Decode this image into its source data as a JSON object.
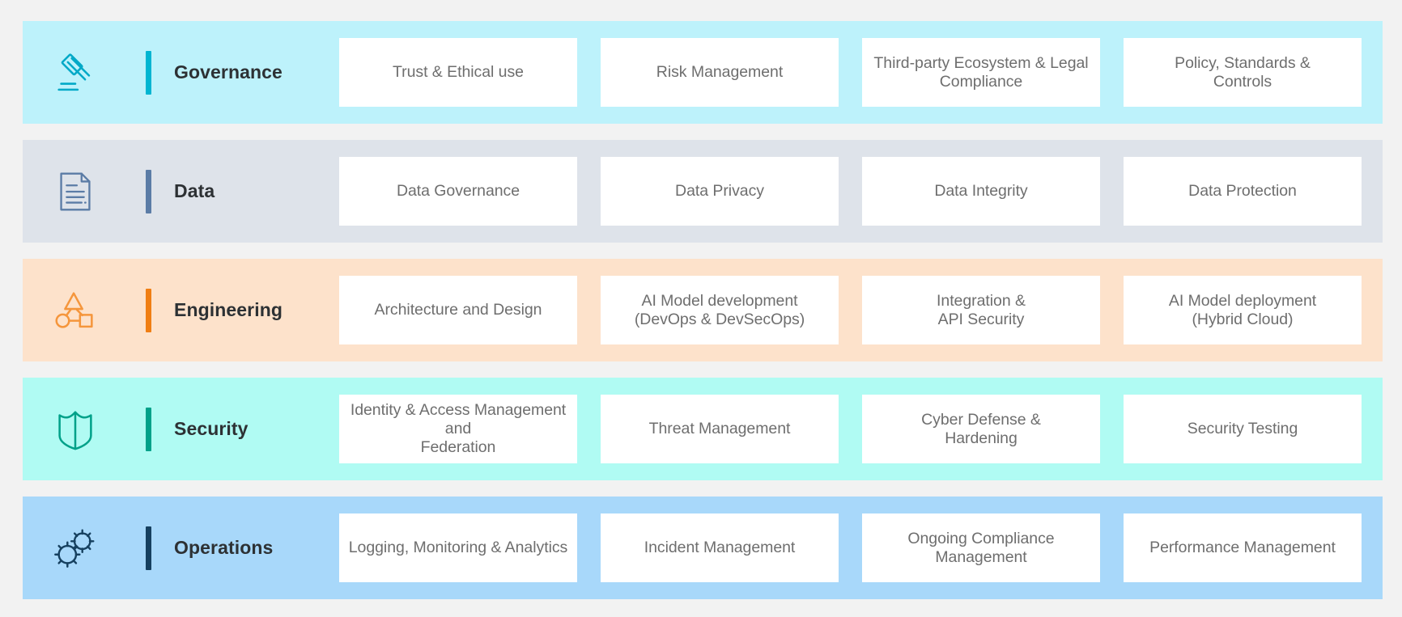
{
  "page": {
    "background": "#f2f2f2",
    "card_background": "#ffffff",
    "card_text_color": "#6e6e6e",
    "row_label_color": "#2d3134"
  },
  "rows": [
    {
      "id": "governance",
      "label": "Governance",
      "icon": "gavel-icon",
      "band_color": "#bdf2fb",
      "accent_color": "#00b5d1",
      "icon_color": "#00a9c7",
      "cards": [
        {
          "label": "Trust & Ethical use"
        },
        {
          "label": "Risk Management"
        },
        {
          "label": "Third-party Ecosystem & Legal\nCompliance"
        },
        {
          "label": "Policy, Standards &\nControls"
        }
      ]
    },
    {
      "id": "data",
      "label": "Data",
      "icon": "document-icon",
      "band_color": "#dee3ea",
      "accent_color": "#5b7ca6",
      "icon_color": "#5b7ca6",
      "cards": [
        {
          "label": "Data Governance"
        },
        {
          "label": "Data Privacy"
        },
        {
          "label": "Data Integrity"
        },
        {
          "label": "Data Protection"
        }
      ]
    },
    {
      "id": "engineering",
      "label": "Engineering",
      "icon": "shapes-network-icon",
      "band_color": "#fde2cb",
      "accent_color": "#f07e13",
      "icon_color": "#f5963c",
      "cards": [
        {
          "label": "Architecture and Design"
        },
        {
          "label": "AI Model development\n(DevOps & DevSecOps)"
        },
        {
          "label": "Integration &\nAPI Security"
        },
        {
          "label": "AI Model deployment\n(Hybrid Cloud)"
        }
      ]
    },
    {
      "id": "security",
      "label": "Security",
      "icon": "shield-icon",
      "band_color": "#b0fbf3",
      "accent_color": "#00a189",
      "icon_color": "#00a189",
      "cards": [
        {
          "label": "Identity & Access Management\nand\nFederation"
        },
        {
          "label": "Threat Management"
        },
        {
          "label": "Cyber Defense &\nHardening"
        },
        {
          "label": "Security Testing"
        }
      ]
    },
    {
      "id": "operations",
      "label": "Operations",
      "icon": "gears-icon",
      "band_color": "#a8d8fa",
      "accent_color": "#16405f",
      "icon_color": "#16405f",
      "cards": [
        {
          "label": "Logging, Monitoring & Analytics"
        },
        {
          "label": "Incident Management"
        },
        {
          "label": "Ongoing Compliance\nManagement"
        },
        {
          "label": "Performance Management"
        }
      ]
    }
  ]
}
